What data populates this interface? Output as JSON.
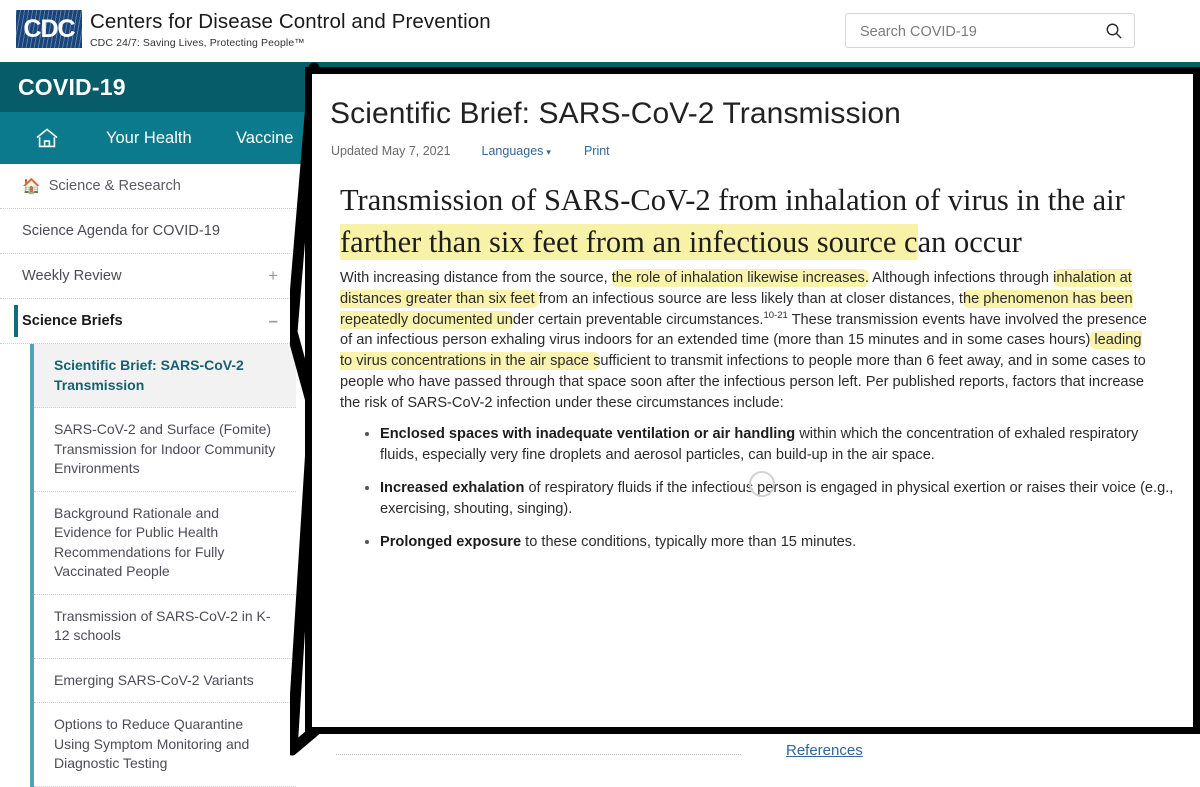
{
  "masthead": {
    "logo_text": "CDC",
    "agency_name": "Centers for Disease Control and Prevention",
    "tagline": "CDC 24/7: Saving Lives, Protecting People™",
    "search_placeholder": "Search COVID-19",
    "search_value": "",
    "search_icon": "search-icon"
  },
  "banner": {
    "title": "COVID-19"
  },
  "nav": {
    "home_icon": "home-icon",
    "items": [
      {
        "label": "Your Health"
      },
      {
        "label": "Vaccine"
      }
    ]
  },
  "sidebar": {
    "home": {
      "label": "Science & Research",
      "icon": "home-icon"
    },
    "items": [
      {
        "label": "Science Agenda for COVID-19",
        "sign": ""
      },
      {
        "label": "Weekly Review",
        "sign": "+"
      },
      {
        "label": "Science Briefs",
        "sign": "–"
      }
    ],
    "sub_items": [
      {
        "label": "Scientific Brief: SARS-CoV-2 Transmission",
        "active": true
      },
      {
        "label": "SARS-CoV-2 and Surface (Fomite) Transmission for Indoor Community Environments",
        "active": false
      },
      {
        "label": "Background Rationale and Evidence for Public Health Recommendations for Fully Vaccinated People",
        "active": false
      },
      {
        "label": "Transmission of SARS-CoV-2 in K-12 schools",
        "active": false
      },
      {
        "label": "Emerging SARS-CoV-2 Variants",
        "active": false
      },
      {
        "label": "Options to Reduce Quarantine Using Symptom Monitoring and Diagnostic Testing",
        "active": false
      }
    ]
  },
  "document": {
    "title": "Scientific Brief: SARS-CoV-2 Transmission",
    "updated": "Updated May 7, 2021",
    "languages_label": "Languages",
    "languages_caret": "▾",
    "print_label": "Print",
    "heading_parts": {
      "p1": "Transmission of SARS-CoV-2 from inhalation of virus in the air ",
      "p2_highlight": "farther than six feet from an infectious source c",
      "p3": "an occur"
    },
    "paragraph_parts": {
      "s1": "With increasing distance from the source, ",
      "s2_highlight": "the role of inhalation likewise increases.",
      "s3": " Although infections through ",
      "s4_highlight": "inhalation at distances greater than six feet ",
      "s5": "from an infectious source are less likely than at closer distances, t",
      "s6_highlight": "he phenomenon has been repeatedly documented un",
      "s7": "der certain preventable circumstances.",
      "s8_sup": "10-21",
      "s9": " These transmission events have involved the presence of an infectious person exhaling virus indoors for an extended time (more than 15 minutes and in some cases hours)",
      "s10_highlight": " leading to virus concentrations in the air space s",
      "s11": "ufficient to transmit infections to people more than 6 feet away, and in some cases to people who have passed through that space soon after the infectious person left. Per published reports, factors that increase the risk of SARS-CoV-2 infection under these circumstances include:"
    },
    "bullets": [
      {
        "bold": "Enclosed spaces with inadequate ventilation or air handling",
        "rest": " within which the concentration of exhaled respiratory fluids, especially very fine droplets and aerosol particles, can build-up in the air space."
      },
      {
        "bold": "Increased exhalation",
        "rest": " of respiratory fluids if the infectious person is engaged in physical exertion or raises their voice (e.g., exercising, shouting, singing)."
      },
      {
        "bold": "Prolonged exposure",
        "rest": " to these conditions, typically more than 15 minutes."
      }
    ],
    "references_label": "References"
  },
  "colors": {
    "cdc_blue": "#17457B",
    "banner_teal": "#075C69",
    "nav_teal": "#0A7A8C",
    "link_blue": "#336699",
    "highlight_yellow": "#F8F2A8",
    "active_teal": "#17606E"
  }
}
